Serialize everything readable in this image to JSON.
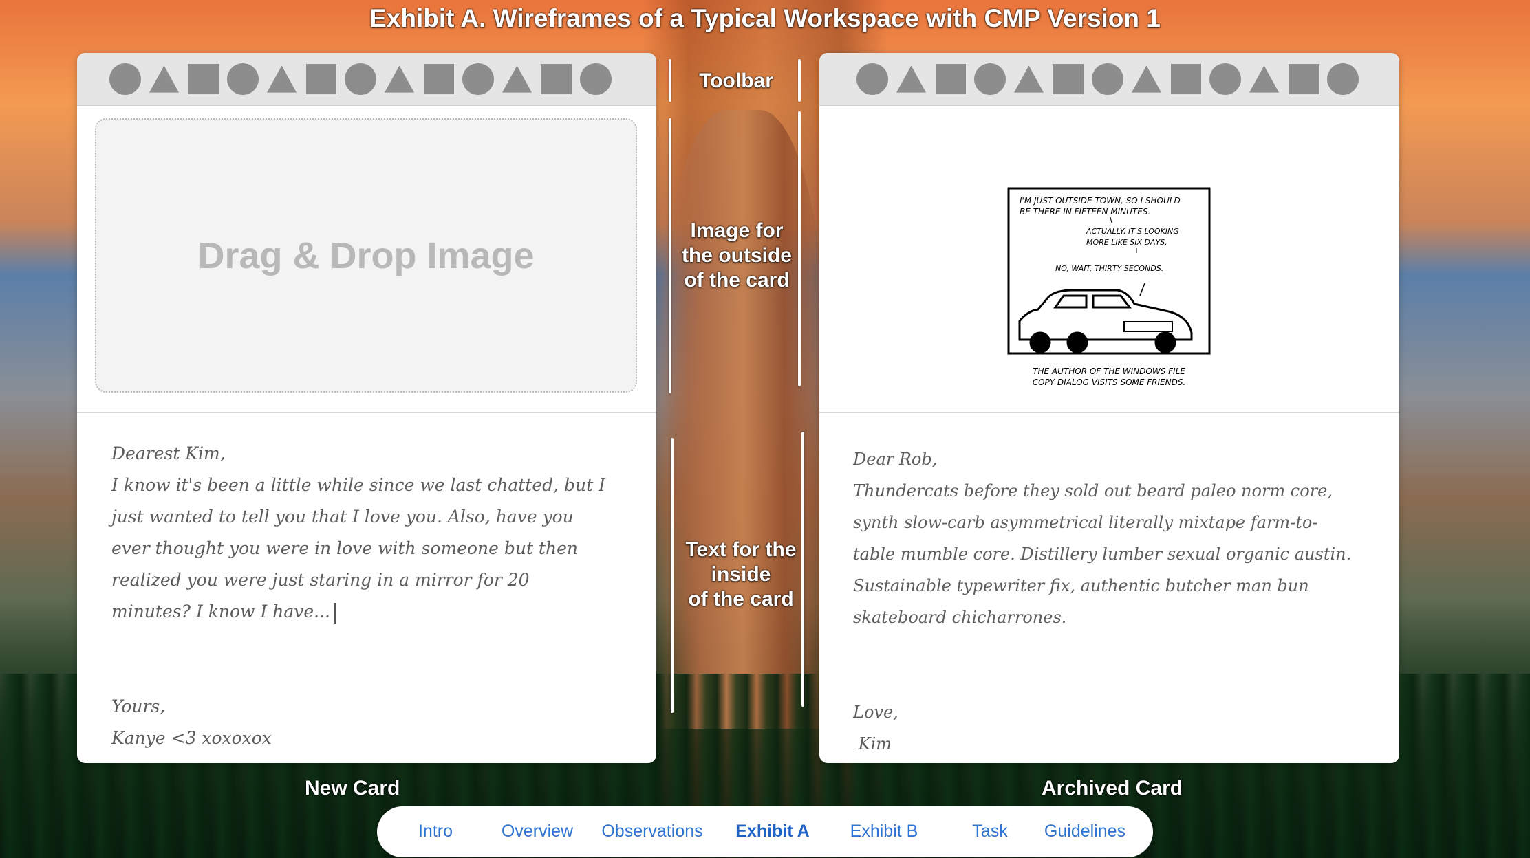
{
  "title": "Exhibit A. Wireframes of a Typical Workspace with CMP Version 1",
  "annotations": {
    "toolbar": "Toolbar",
    "image_outside": "Image for\nthe outside\nof the card",
    "text_inside": "Text for the\ninside\nof the card"
  },
  "new_card": {
    "caption": "New Card",
    "toolbar_icons": [
      "circle-icon",
      "triangle-icon",
      "square-icon",
      "circle-icon",
      "triangle-icon",
      "square-icon",
      "circle-icon",
      "triangle-icon",
      "square-icon",
      "circle-icon",
      "triangle-icon",
      "square-icon",
      "circle-icon"
    ],
    "dropzone_label": "Drag & Drop Image",
    "message": "Dearest Kim,\nI know it's been a little while since we last chatted, but I just wanted to tell you that I love you. Also, have you ever thought you were in love with someone but then realized you were just staring in a mirror for 20 minutes? I know I have...",
    "closing": "Yours,\nKanye <3 xoxoxox"
  },
  "archived_card": {
    "caption": "Archived Card",
    "toolbar_icons": [
      "circle-icon",
      "triangle-icon",
      "square-icon",
      "circle-icon",
      "triangle-icon",
      "square-icon",
      "circle-icon",
      "triangle-icon",
      "square-icon",
      "circle-icon",
      "triangle-icon",
      "square-icon",
      "circle-icon"
    ],
    "comic": {
      "line1": "I'M JUST OUTSIDE TOWN, SO I SHOULD",
      "line2": "BE THERE IN FIFTEEN MINUTES.",
      "line3": "ACTUALLY, IT'S LOOKING",
      "line4": "MORE LIKE SIX DAYS.",
      "line5": "NO, WAIT, THIRTY SECONDS.",
      "caption1": "THE AUTHOR OF THE WINDOWS FILE",
      "caption2": "COPY DIALOG VISITS SOME FRIENDS."
    },
    "message": "Dear Rob,\nThundercats before they sold out beard paleo norm core, synth slow-carb asymmetrical literally mixtape farm-to-table mumble core. Distillery lumber sexual organic austin. Sustainable typewriter fix, authentic butcher man bun skateboard chicharrones.",
    "closing": "Love,\n Kim"
  },
  "nav": {
    "items": [
      "Intro",
      "Overview",
      "Observations",
      "Exhibit A",
      "Exhibit B",
      "Task",
      "Guidelines"
    ],
    "active": "Exhibit A"
  },
  "colors": {
    "toolbar_bg": "#e5e5e5",
    "icon_gray": "#8d8d8d",
    "nav_link": "#2f74d0"
  }
}
